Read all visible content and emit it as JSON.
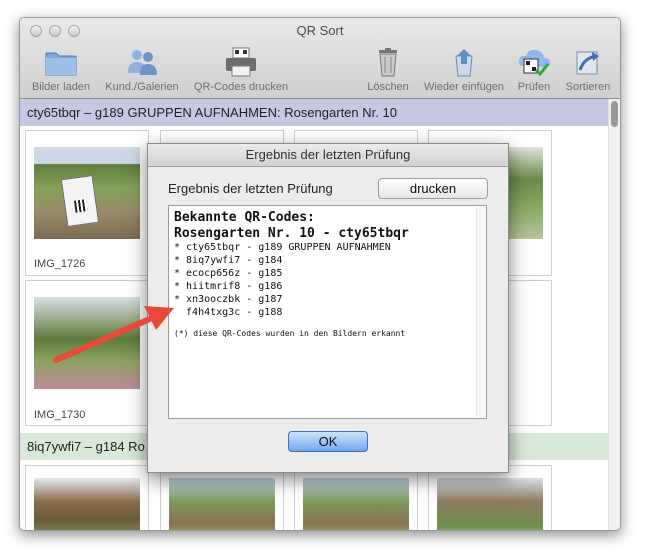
{
  "window": {
    "title": "QR Sort"
  },
  "toolbar": {
    "bilder_laden": "Bilder laden",
    "kunden_galerien": "Kund./Galerien",
    "qr_drucken": "QR-Codes drucken",
    "loeschen": "Löschen",
    "wieder_einfuegen": "Wieder einfügen",
    "pruefen": "Prüfen",
    "sortieren": "Sortieren"
  },
  "groups": [
    {
      "header": "cty65tbqr – g189  GRUPPEN AUFNAHMEN: Rosengarten Nr. 10",
      "selected": true,
      "thumbs": [
        "IMG_1726",
        "IMG_1730"
      ]
    },
    {
      "header": "8iq7ywfi7 – g184  Ro",
      "selected": false
    }
  ],
  "dialog": {
    "title": "Ergebnis der letzten Prüfung",
    "label": "Ergebnis der letzten Prüfung",
    "print_button": "drucken",
    "ok_button": "OK",
    "text": {
      "heading1": "Bekannte QR-Codes:",
      "heading2": "Rosengarten Nr. 10 - cty65tbqr",
      "lines": [
        "* cty65tbqr - g189 GRUPPEN AUFNAHMEN",
        "* 8iq7ywfi7 - g184",
        "* ecocp656z - g185",
        "* hiitmrif8 - g186",
        "* xn3ooczbk - g187",
        "  f4h4txg3c - g188"
      ],
      "footnote": "(*) diese QR-Codes wurden in den Bildern erkannt"
    }
  },
  "colors": {
    "selected_group": "#c7c9e3",
    "other_group": "#d9e8d8",
    "arrow": "#e8493a",
    "ok_button": "#6fa8ee"
  }
}
